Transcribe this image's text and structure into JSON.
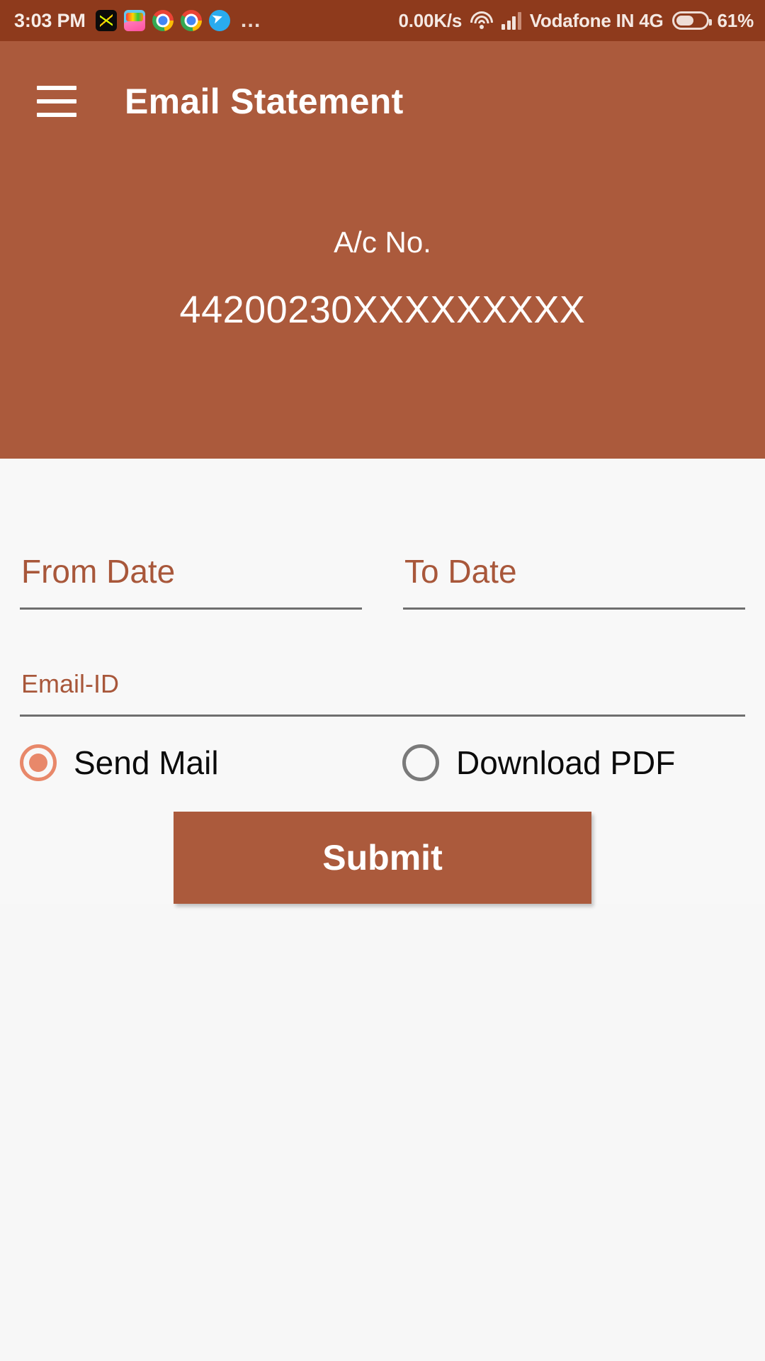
{
  "status_bar": {
    "time": "3:03 PM",
    "network_speed": "0.00K/s",
    "carrier": "Vodafone IN 4G",
    "battery_percent": "61%",
    "battery_level": 61,
    "app_icons": [
      "dance-app-icon",
      "game-app-icon",
      "chrome-icon",
      "chrome-icon",
      "telegram-icon"
    ],
    "overflow": "…",
    "icons": [
      "wifi-icon",
      "signal-icon",
      "battery-icon"
    ],
    "background_color": "#8E3A1C"
  },
  "app_bar": {
    "menu_icon": "hamburger-menu-icon",
    "title": "Email Statement",
    "background_color": "#AB5A3C"
  },
  "account_header": {
    "label": "A/c No.",
    "number": "44200230XXXXXXXXX",
    "background_color": "#AB5A3C"
  },
  "form": {
    "from_date": {
      "placeholder": "From Date",
      "value": ""
    },
    "to_date": {
      "placeholder": "To Date",
      "value": ""
    },
    "email_id": {
      "placeholder": "Email-ID",
      "value": ""
    },
    "delivery_options": [
      {
        "label": "Send Mail",
        "selected": true
      },
      {
        "label": "Download PDF",
        "selected": false
      }
    ],
    "submit_label": "Submit",
    "accent_color": "#A8573A",
    "radio_selected_color": "#E8886A"
  }
}
